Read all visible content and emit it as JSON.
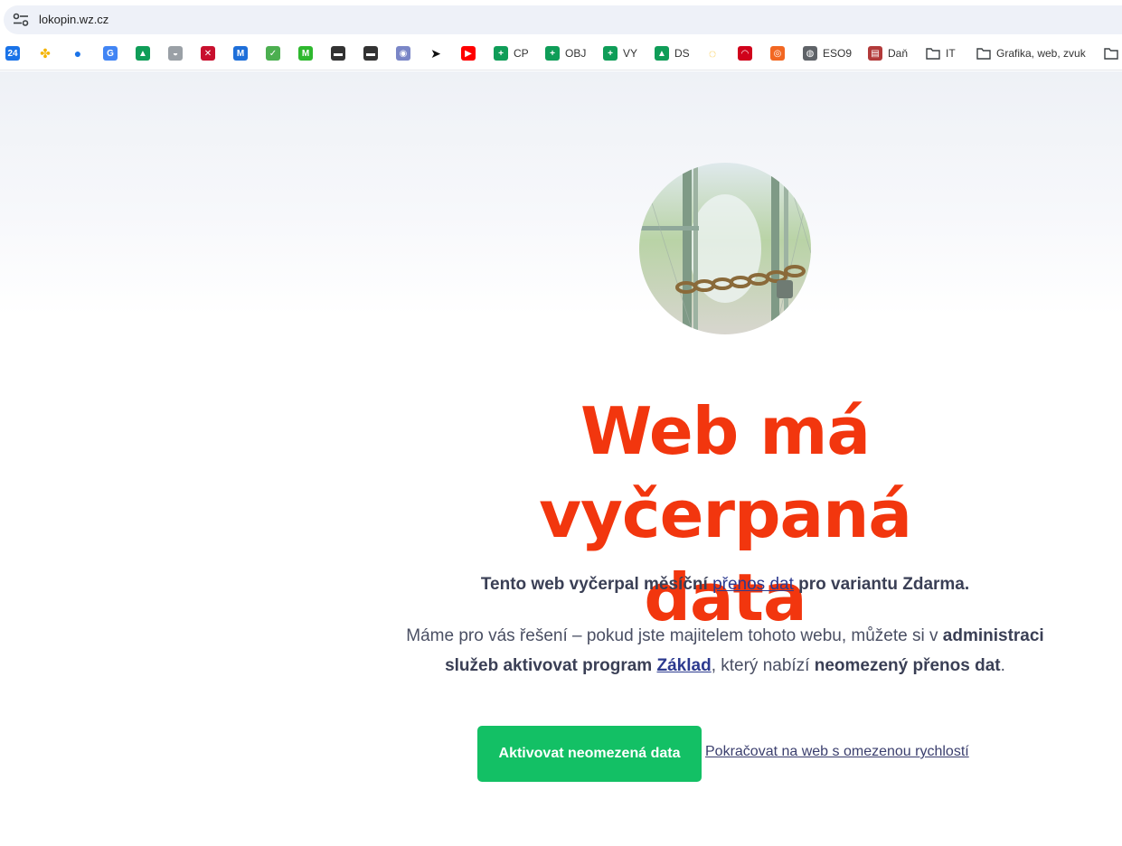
{
  "browser": {
    "url": "lokopin.wz.cz",
    "bookmarks": [
      {
        "name": "bookmark-calendar",
        "icon": "calendar-icon",
        "label": "",
        "glyph": "24",
        "color": "#1a73e8"
      },
      {
        "name": "bookmark-photos",
        "icon": "pinwheel-icon",
        "label": "",
        "glyph": "✤",
        "color": "#f4b400"
      },
      {
        "name": "bookmark-contacts",
        "icon": "person-icon",
        "label": "",
        "glyph": "●",
        "color": "#1a73e8"
      },
      {
        "name": "bookmark-translate",
        "icon": "translate-icon",
        "label": "",
        "glyph": "G",
        "color": "#4285f4"
      },
      {
        "name": "bookmark-drive",
        "icon": "drive-icon",
        "label": "",
        "glyph": "▲",
        "color": "#0f9d58"
      },
      {
        "name": "bookmark-basket",
        "icon": "basket-icon",
        "label": "",
        "glyph": "◒",
        "color": "#9aa0a6"
      },
      {
        "name": "bookmark-flag",
        "icon": "union-flag-icon",
        "label": "",
        "glyph": "✕",
        "color": "#c8102e"
      },
      {
        "name": "bookmark-m-blue",
        "icon": "m-logo-icon",
        "label": "",
        "glyph": "M",
        "color": "#1e6fd9"
      },
      {
        "name": "bookmark-check",
        "icon": "checkbox-icon",
        "label": "",
        "glyph": "✓",
        "color": "#4caf50"
      },
      {
        "name": "bookmark-m-green",
        "icon": "m-circle-icon",
        "label": "",
        "glyph": "M",
        "color": "#2eb82e"
      },
      {
        "name": "bookmark-film-1",
        "icon": "film-icon",
        "label": "",
        "glyph": "▬",
        "color": "#333333"
      },
      {
        "name": "bookmark-film-2",
        "icon": "film-icon",
        "label": "",
        "glyph": "▬",
        "color": "#333333"
      },
      {
        "name": "bookmark-avatar",
        "icon": "avatar-icon",
        "label": "",
        "glyph": "◉",
        "color": "#7a86c7"
      },
      {
        "name": "bookmark-cursor",
        "icon": "cursor-icon",
        "label": "",
        "glyph": "➤",
        "color": "#111111"
      },
      {
        "name": "bookmark-youtube",
        "icon": "youtube-icon",
        "label": "",
        "glyph": "▶",
        "color": "#ff0000"
      },
      {
        "name": "bookmark-cp",
        "icon": "sheets-icon",
        "label": "CP",
        "glyph": "+",
        "color": "#0f9d58"
      },
      {
        "name": "bookmark-obj",
        "icon": "sheets-icon",
        "label": "OBJ",
        "glyph": "+",
        "color": "#0f9d58"
      },
      {
        "name": "bookmark-vy",
        "icon": "sheets-icon",
        "label": "VY",
        "glyph": "+",
        "color": "#0f9d58"
      },
      {
        "name": "bookmark-ds",
        "icon": "drive-icon",
        "label": "DS",
        "glyph": "▲",
        "color": "#0f9d58"
      },
      {
        "name": "bookmark-ring",
        "icon": "ring-icon",
        "label": "",
        "glyph": "◌",
        "color": "#f4b400"
      },
      {
        "name": "bookmark-red",
        "icon": "red-logo-icon",
        "label": "",
        "glyph": "◠",
        "color": "#d0021b"
      },
      {
        "name": "bookmark-orange",
        "icon": "orange-circle-icon",
        "label": "",
        "glyph": "◎",
        "color": "#f26722"
      },
      {
        "name": "bookmark-eso9",
        "icon": "globe-icon",
        "label": "ESO9",
        "glyph": "◍",
        "color": "#5f6368"
      },
      {
        "name": "bookmark-dan",
        "icon": "document-icon",
        "label": "Daň",
        "glyph": "▤",
        "color": "#b23a3a"
      },
      {
        "name": "bookmark-it",
        "icon": "folder-icon",
        "label": "IT",
        "glyph": "",
        "color": "#ffffff"
      },
      {
        "name": "bookmark-grafika",
        "icon": "folder-icon",
        "label": "Grafika, web, zvuk",
        "glyph": "",
        "color": "#ffffff"
      },
      {
        "name": "bookmark-more-folder",
        "icon": "folder-icon",
        "label": "",
        "glyph": "",
        "color": "#ffffff"
      }
    ]
  },
  "page": {
    "hero_icon": "padlock-gate-icon",
    "heading_line1": "Web má vyčerpaná",
    "heading_line2": "data",
    "lead_before": "Tento web vyčerpal měsíční ",
    "lead_link": "přenos dat",
    "lead_after": " pro variantu Zdarma.",
    "desc_part1": "Máme pro vás řešení – pokud jste majitelem tohoto webu, můžete si v ",
    "desc_bold1": "administraci služeb aktivovat program",
    "desc_space": " ",
    "desc_link": "Základ",
    "desc_part2": ", který nabízí ",
    "desc_bold2": "neomezený přenos dat",
    "desc_end": ".",
    "cta_label": "Aktivovat neomezená data",
    "continue_label": "Pokračovat na web s omezenou rychlostí",
    "colors": {
      "heading": "#f2360e",
      "cta": "#13c065",
      "link": "#2c3a8f"
    }
  }
}
